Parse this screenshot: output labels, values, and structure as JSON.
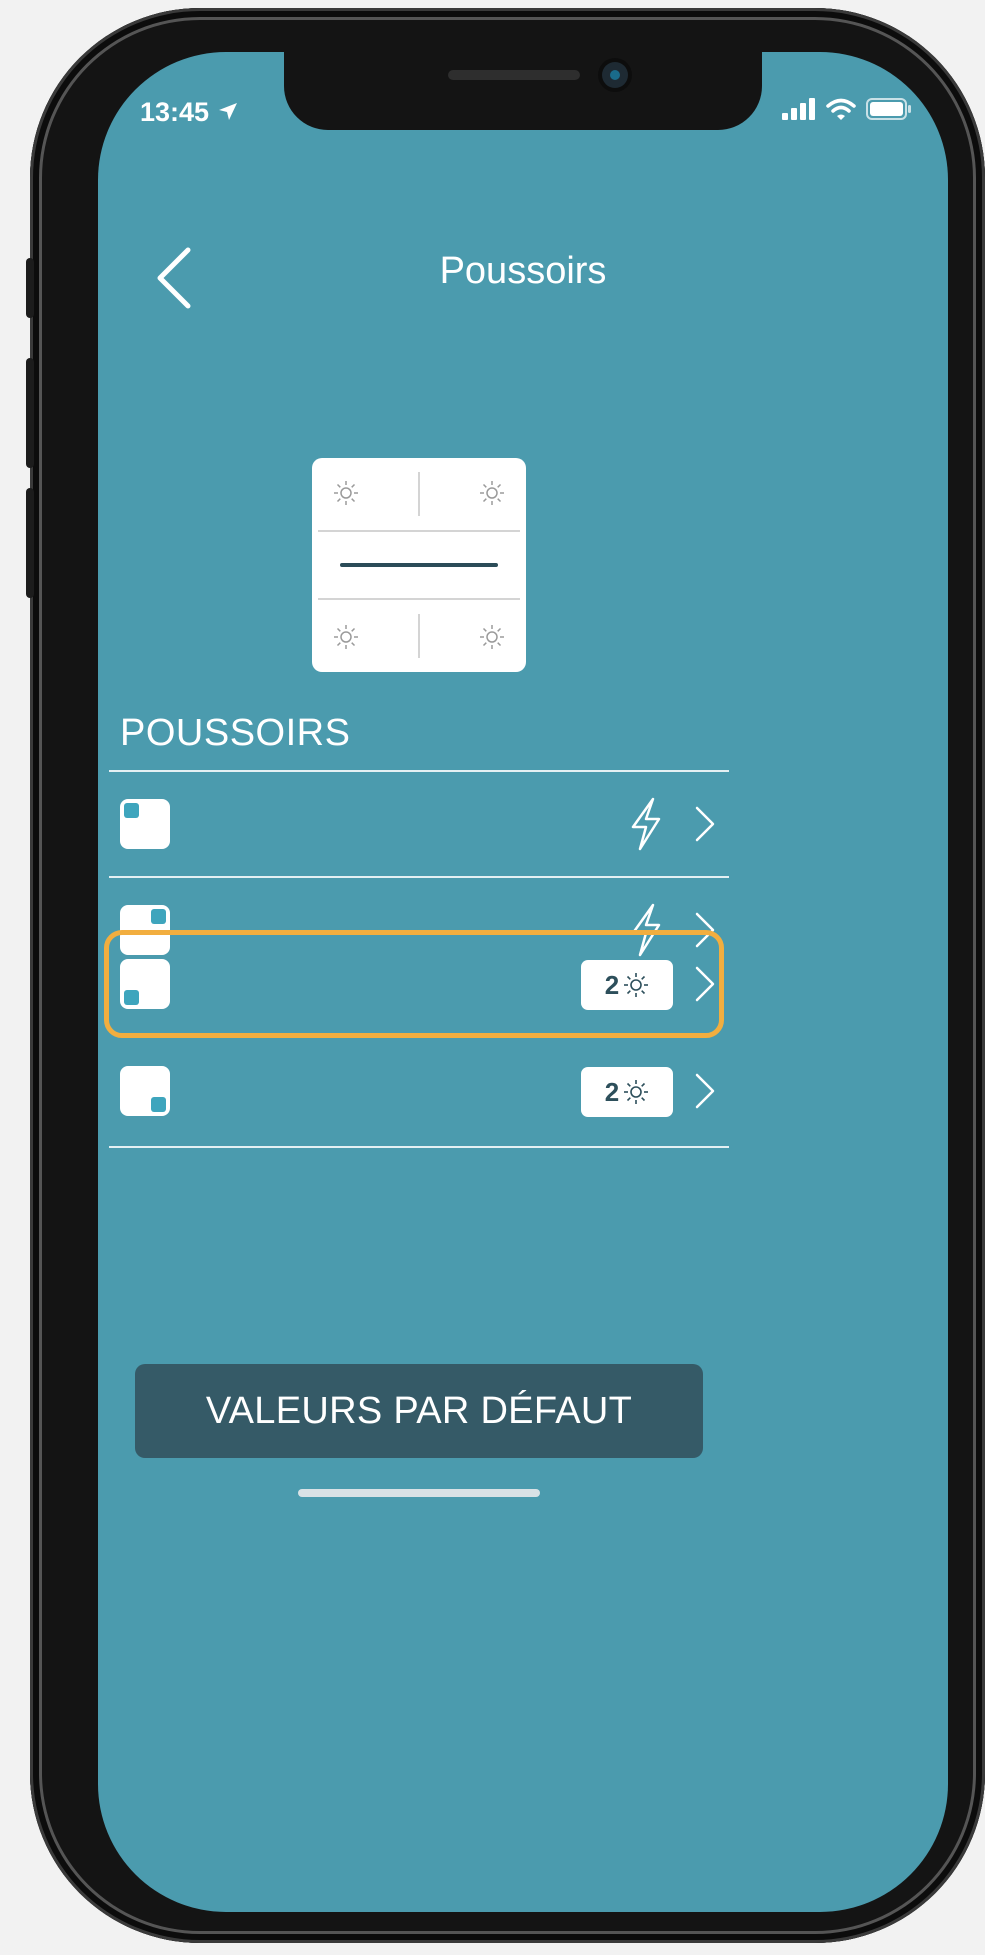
{
  "status_bar": {
    "time": "13:45",
    "icons": [
      "location-arrow-icon",
      "cellular-signal-icon",
      "wifi-icon",
      "battery-icon"
    ]
  },
  "nav": {
    "back_icon": "chevron-left-icon",
    "title": "Poussoirs"
  },
  "preview": {
    "icon": "sun-icon",
    "quadrants": 4
  },
  "section": {
    "header": "POUSSOIRS"
  },
  "pushbuttons": [
    {
      "position": "top-left",
      "indicator": "lightning-icon"
    },
    {
      "position": "top-right",
      "indicator": "lightning-icon"
    },
    {
      "position": "bottom-left",
      "indicator": "badge",
      "badge_count": "2",
      "badge_icon": "sun-icon",
      "highlighted": true
    },
    {
      "position": "bottom-right",
      "indicator": "badge",
      "badge_count": "2",
      "badge_icon": "sun-icon"
    }
  ],
  "footer": {
    "default_button_label": "VALEURS PAR DÉFAUT"
  },
  "colors": {
    "screen_background": "#4b9bae",
    "button_dark": "#355a67",
    "highlight": "#f2ae3f",
    "indicator_dot": "#3ea5bd"
  }
}
